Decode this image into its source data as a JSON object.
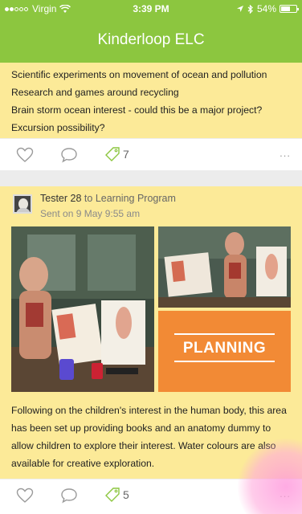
{
  "status_bar": {
    "carrier": "Virgin",
    "time": "3:39 PM",
    "battery": "54%",
    "battery_level": 0.54
  },
  "nav": {
    "title": "Kinderloop ELC"
  },
  "post1": {
    "lines": [
      "Scientific experiments on movement of ocean and pollution",
      "Research and games around recycling",
      "Brain storm ocean interest - could this be a major project?",
      "Excursion possibility?"
    ],
    "tag_count": "7",
    "more": "..."
  },
  "post2": {
    "author": "Tester 28",
    "to_label": "to",
    "program": "Learning Program",
    "sent": "Sent on 9 May 9:55 am",
    "photo_label": "PLANNING",
    "caption": "Following on the children's interest in the human body, this area has been set up providing books and an anatomy dummy to allow children to explore their interest. Water colours are also available for creative exploration.",
    "tag_count": "5",
    "more": "..."
  },
  "colors": {
    "brand_green": "#8cc63f",
    "card_yellow": "#fcea98",
    "planning_orange": "#f28a35",
    "tag_green": "#8cc63f"
  }
}
